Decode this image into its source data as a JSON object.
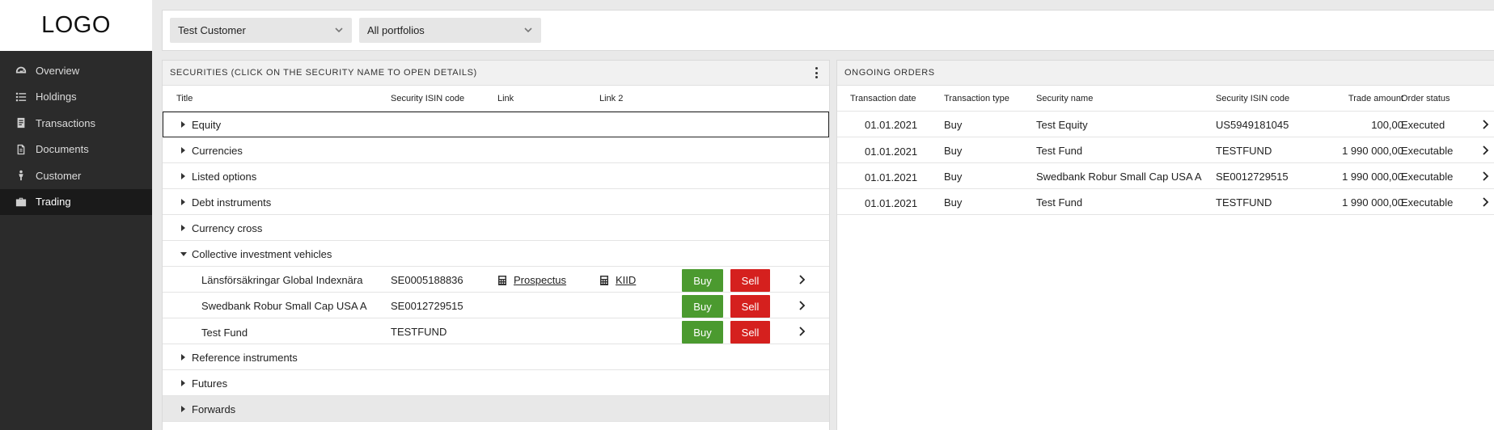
{
  "sidebar": {
    "logo": "LOGO",
    "items": [
      {
        "label": "Overview",
        "icon": "gauge-icon"
      },
      {
        "label": "Holdings",
        "icon": "list-icon"
      },
      {
        "label": "Transactions",
        "icon": "receipt-icon"
      },
      {
        "label": "Documents",
        "icon": "document-icon"
      },
      {
        "label": "Customer",
        "icon": "person-icon"
      },
      {
        "label": "Trading",
        "icon": "briefcase-icon",
        "active": true
      }
    ]
  },
  "topbar": {
    "customer_select": "Test Customer",
    "portfolio_select": "All portfolios"
  },
  "securities": {
    "header": "SECURITIES (CLICK ON THE SECURITY NAME TO OPEN DETAILS)",
    "columns": [
      "Title",
      "Security ISIN code",
      "Link",
      "Link 2"
    ],
    "categories": [
      {
        "label": "Equity"
      },
      {
        "label": "Currencies"
      },
      {
        "label": "Listed options"
      },
      {
        "label": "Debt instruments"
      },
      {
        "label": "Currency cross"
      },
      {
        "label": "Collective investment vehicles"
      },
      {
        "label": "Reference instruments"
      },
      {
        "label": "Futures"
      },
      {
        "label": "Forwards"
      }
    ],
    "funds": [
      {
        "name": "Länsförsäkringar Global Indexnära",
        "isin": "SE0005188836",
        "link": "Prospectus",
        "link2": "KIID"
      },
      {
        "name": "Swedbank Robur Small Cap USA A",
        "isin": "SE0012729515",
        "link": "",
        "link2": ""
      },
      {
        "name": "Test Fund",
        "isin": "TESTFUND",
        "link": "",
        "link2": ""
      }
    ],
    "buy_label": "Buy",
    "sell_label": "Sell"
  },
  "orders": {
    "header": "ONGOING ORDERS",
    "columns": [
      "Transaction date",
      "Transaction type",
      "Security name",
      "Security ISIN code",
      "Trade amount",
      "Order status"
    ],
    "rows": [
      {
        "date": "01.01.2021",
        "type": "Buy",
        "name": "Test Equity",
        "isin": "US5949181045",
        "amount": "100,00",
        "status": "Executed"
      },
      {
        "date": "01.01.2021",
        "type": "Buy",
        "name": "Test Fund",
        "isin": "TESTFUND",
        "amount": "1 990 000,00",
        "status": "Executable"
      },
      {
        "date": "01.01.2021",
        "type": "Buy",
        "name": "Swedbank Robur Small Cap USA A",
        "isin": "SE0012729515",
        "amount": "1 990 000,00",
        "status": "Executable"
      },
      {
        "date": "01.01.2021",
        "type": "Buy",
        "name": "Test Fund",
        "isin": "TESTFUND",
        "amount": "1 990 000,00",
        "status": "Executable"
      }
    ]
  },
  "colors": {
    "buy": "#4b9a2f",
    "sell": "#d5201e",
    "sidebar": "#2b2b2b"
  }
}
